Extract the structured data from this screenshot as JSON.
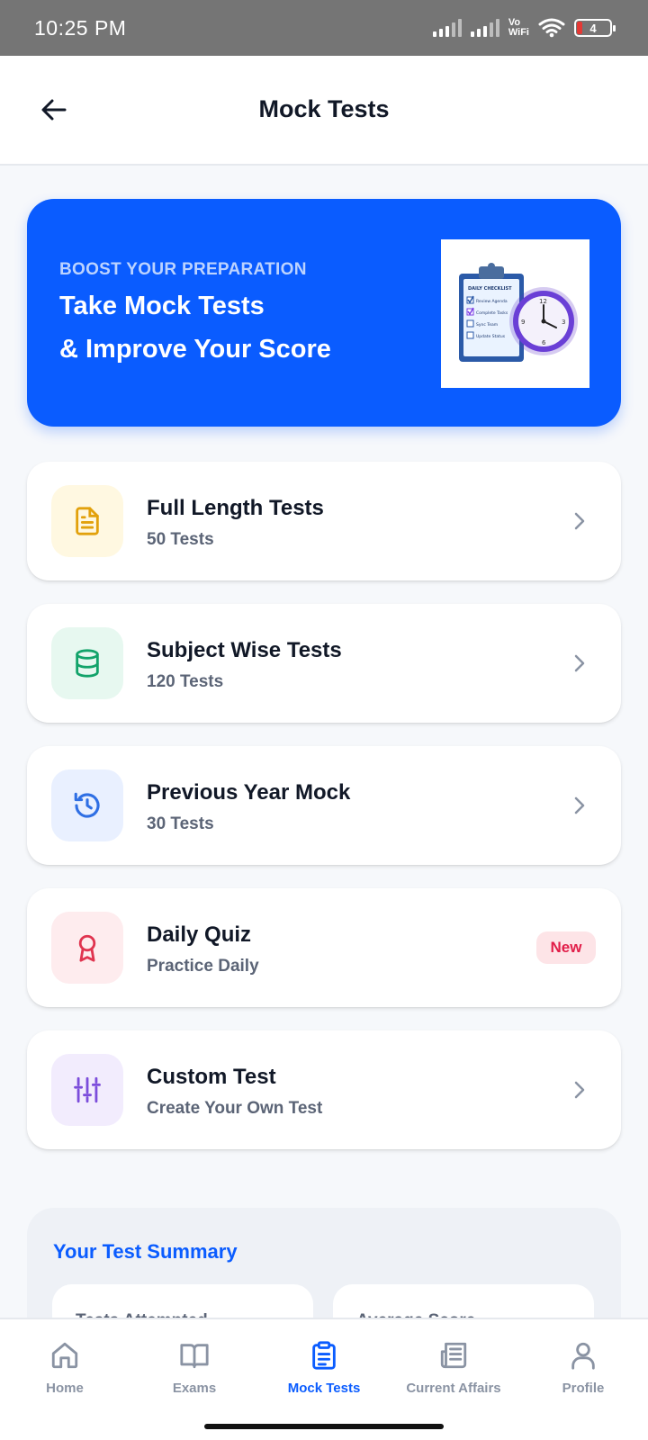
{
  "status_bar": {
    "time": "10:25 PM",
    "vo_line1": "Vo",
    "vo_line2": "WiFi",
    "battery": "4"
  },
  "header": {
    "title": "Mock Tests",
    "back_icon": "arrow-left-icon"
  },
  "banner": {
    "eyebrow": "BOOST YOUR PREPARATION",
    "line1": "Take Mock Tests",
    "line2": "& Improve Your Score",
    "image_texts": [
      "DAILY CHECKLIST",
      "Review Agenda",
      "Complete Tasks",
      "Sync Team",
      "Update Status"
    ],
    "image_clock_numbers": [
      "12",
      "3",
      "6",
      "9"
    ]
  },
  "categories": [
    {
      "title": "Full Length Tests",
      "subtitle": "50 Tests",
      "icon": "document-icon",
      "color": "#e2a10c",
      "bg": "#fff8e1",
      "trailing": "chevron"
    },
    {
      "title": "Subject Wise Tests",
      "subtitle": "120 Tests",
      "icon": "database-icon",
      "color": "#12a36a",
      "bg": "#e7f8f0",
      "trailing": "chevron"
    },
    {
      "title": "Previous Year Mock",
      "subtitle": "30 Tests",
      "icon": "history-icon",
      "color": "#2f6fe4",
      "bg": "#e9f0ff",
      "trailing": "chevron"
    },
    {
      "title": "Daily Quiz",
      "subtitle": "Practice Daily",
      "icon": "award-icon",
      "color": "#e0344f",
      "bg": "#feecee",
      "trailing": "badge",
      "badge": "New"
    },
    {
      "title": "Custom Test",
      "subtitle": "Create Your Own Test",
      "icon": "sliders-icon",
      "color": "#7c4ddb",
      "bg": "#f2ecfd",
      "trailing": "chevron"
    }
  ],
  "summary": {
    "title": "Your Test Summary",
    "stats": [
      {
        "label": "Tests Attempted"
      },
      {
        "label": "Average Score"
      }
    ]
  },
  "bottom_nav": [
    {
      "label": "Home",
      "icon": "home-icon",
      "active": false
    },
    {
      "label": "Exams",
      "icon": "book-icon",
      "active": false
    },
    {
      "label": "Mock Tests",
      "icon": "clipboard-icon",
      "active": true
    },
    {
      "label": "Current Affairs",
      "icon": "newspaper-icon",
      "active": false
    },
    {
      "label": "Profile",
      "icon": "user-icon",
      "active": false
    }
  ],
  "colors": {
    "primary": "#0a5cff",
    "status_bar": "#757575",
    "background": "#f6f8fb",
    "nav_inactive": "#8a93a3"
  }
}
